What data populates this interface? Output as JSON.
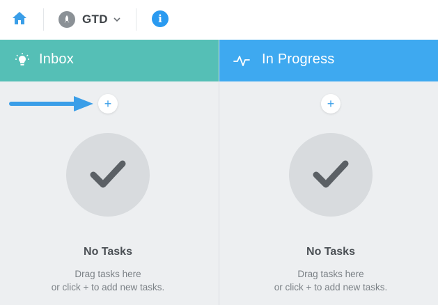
{
  "topbar": {
    "home_icon": "home-icon",
    "project": {
      "name": "GTD",
      "avatar_icon": "rocket-icon",
      "dropdown_icon": "chevron-down-icon"
    },
    "info_label": "i"
  },
  "columns": [
    {
      "title": "Inbox",
      "icon": "lightbulb-icon",
      "header_color": "#55bfb6",
      "add_label": "+",
      "empty_title": "No Tasks",
      "empty_line1": "Drag tasks here",
      "empty_line2": "or click + to add new tasks."
    },
    {
      "title": "In Progress",
      "icon": "activity-icon",
      "header_color": "#3ea9f0",
      "add_label": "+",
      "empty_title": "No Tasks",
      "empty_line1": "Drag tasks here",
      "empty_line2": "or click + to add new tasks."
    }
  ],
  "colors": {
    "accent_blue": "#2a9af0",
    "arrow": "#3a9ee8"
  }
}
